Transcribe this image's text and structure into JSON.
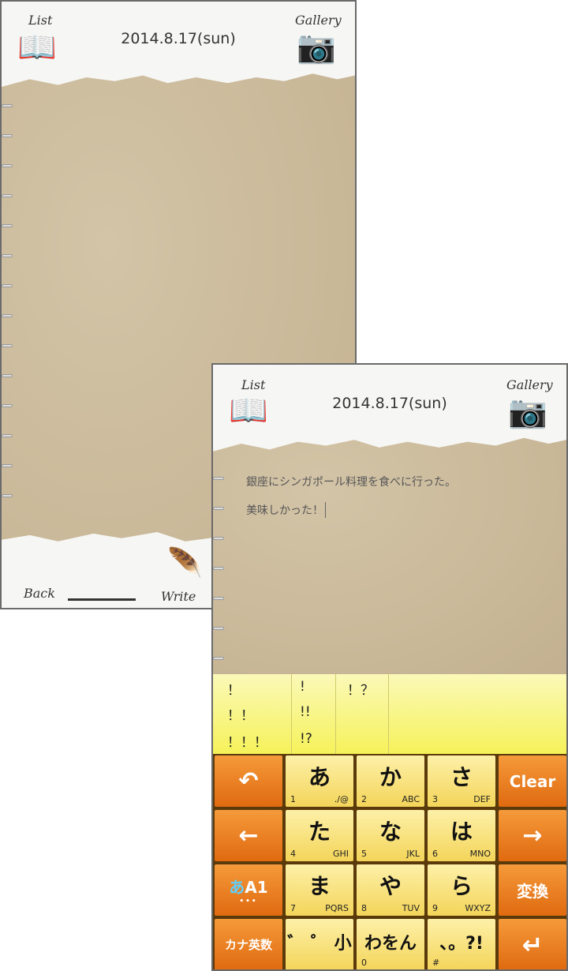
{
  "screen1": {
    "list_label": "List",
    "gallery_label": "Gallery",
    "date": "2014.8.17(sun)",
    "back_label": "Back",
    "write_label": "Write"
  },
  "screen2": {
    "list_label": "List",
    "gallery_label": "Gallery",
    "date": "2014.8.17(sun)",
    "lines": [
      "銀座にシンガポール料理を食べに行った。",
      "美味しかった！"
    ],
    "candidates": {
      "col1": [
        "！",
        "！！",
        "！！！"
      ],
      "col2": [
        "!",
        "!!",
        "!?"
      ],
      "col3": [
        "！？"
      ]
    }
  },
  "keyboard": {
    "undo_icon": "undo-icon",
    "clear": "Clear",
    "left_icon": "arrow-left-icon",
    "right_icon": "arrow-right-icon",
    "mode_kana": "あ",
    "mode_alnum": "A1",
    "mode_dots": "•••",
    "convert": "変換",
    "kana_eisu": "カナ英数",
    "enter_icon": "enter-icon",
    "keys": [
      {
        "kana": "あ",
        "num": "1",
        "alt": "./@"
      },
      {
        "kana": "か",
        "num": "2",
        "alt": "ABC"
      },
      {
        "kana": "さ",
        "num": "3",
        "alt": "DEF"
      },
      {
        "kana": "た",
        "num": "4",
        "alt": "GHI"
      },
      {
        "kana": "な",
        "num": "5",
        "alt": "JKL"
      },
      {
        "kana": "は",
        "num": "6",
        "alt": "MNO"
      },
      {
        "kana": "ま",
        "num": "7",
        "alt": "PQRS"
      },
      {
        "kana": "や",
        "num": "8",
        "alt": "TUV"
      },
      {
        "kana": "ら",
        "num": "9",
        "alt": "WXYZ"
      },
      {
        "kana": "゛ ゜ 小",
        "num": "",
        "alt": ""
      },
      {
        "kana": "わをん",
        "num": "0",
        "alt": ""
      },
      {
        "kana": "、。?!",
        "num": "#",
        "alt": ""
      }
    ]
  },
  "colors": {
    "orange": "#e8781c",
    "yellow": "#f6e27a",
    "candidate_bg": "#f7f48a",
    "paper": "#cdbd9f"
  }
}
